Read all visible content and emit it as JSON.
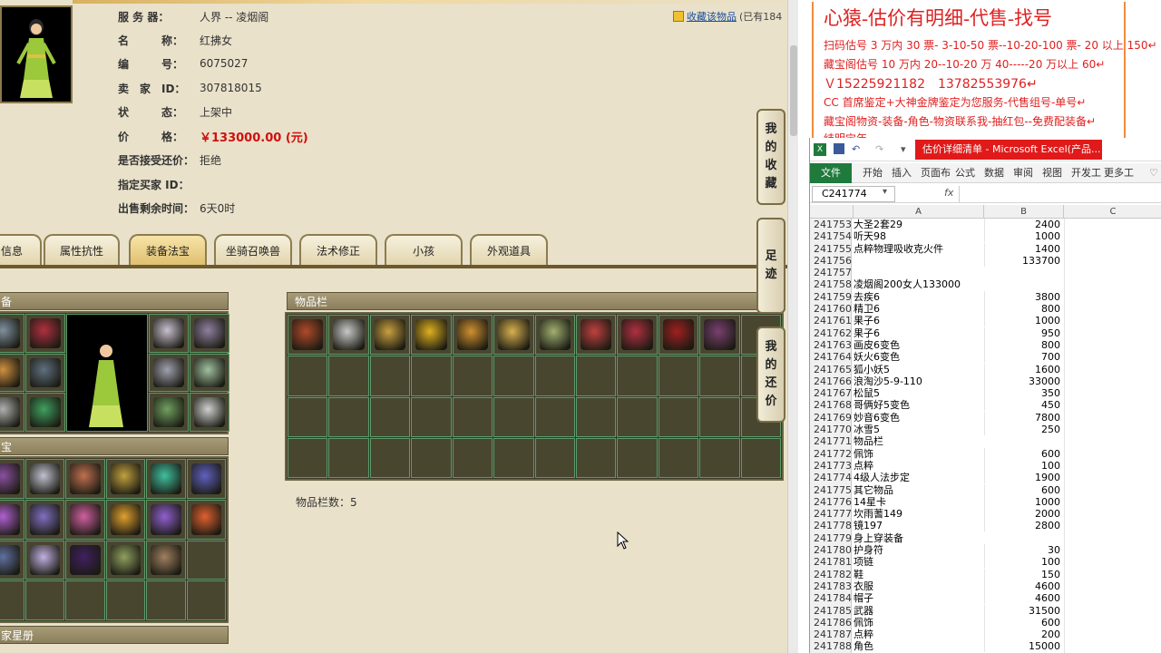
{
  "seller_info": {
    "server_label": "服 务 器：",
    "server_value": "人界 -- 凌烟阁",
    "name_label": "名　　　称：",
    "name_value": "红拂女",
    "id_label": "编　　　号：",
    "id_value": "6075027",
    "seller_label": "卖　家　ID：",
    "seller_value": "307818015",
    "status_label": "状　　　态：",
    "status_value": "上架中",
    "price_label": "价　　　格：",
    "price_value": "￥133000.00 (元)",
    "counter_label": "是否接受还价：",
    "counter_value": "拒绝",
    "buyer_label": "指定买家 ID：",
    "buyer_value": "",
    "remaining_label": "出售剩余时间：",
    "remaining_value": "6天0时"
  },
  "favorite": {
    "link_label": "收藏该物品",
    "count_text": "(已有184"
  },
  "tabs": [
    "信息",
    "属性抗性",
    "装备法宝",
    "坐骑召唤兽",
    "法术修正",
    "小孩",
    "外观道具"
  ],
  "panels": {
    "equip_header": "备",
    "fabao_header": "宝",
    "bottom_header": "家星册",
    "inventory_header": "物品栏",
    "inventory_count": "物品栏数：5"
  },
  "side_buttons": [
    {
      "label": "我的收藏",
      "chars": [
        "我",
        "的",
        "收",
        "藏"
      ]
    },
    {
      "label": "足迹",
      "chars": [
        "足",
        "迹"
      ]
    },
    {
      "label": "我的还价",
      "chars": [
        "我",
        "的",
        "还",
        "价"
      ]
    }
  ],
  "promo": {
    "headline": "心猿-估价有明细-代售-找号",
    "line1": "扫码估号 3 万内 30 票- 3-10-50 票--10-20-100 票- 20 以上 150↵",
    "line2": "藏宝阁估号 10 万内 20--10-20 万 40-----20 万以上 60↵",
    "line3": "Ｖ15225921182　13782553976↵",
    "line4": "CC 首席鉴定+大神金牌鉴定为您服务-代售组号-单号↵",
    "line5": "藏宝阁物资-装备-角色-物资联系我-抽红包--免费配装备↵",
    "line6": "结明宝年　……　………　………"
  },
  "excel": {
    "window_title": "估价详细清单 - Microsoft Excel(产品...",
    "ribbon_tabs": [
      "文件",
      "开始",
      "插入",
      "页面布",
      "公式",
      "数据",
      "审阅",
      "视图",
      "开发工",
      "更多工"
    ],
    "name_box": "C241774",
    "fx": "fx",
    "columns": [
      "A",
      "B",
      "C"
    ],
    "rows": [
      {
        "n": "241753",
        "a": "大圣2套29",
        "b": "2400"
      },
      {
        "n": "241754",
        "a": "听天98",
        "b": "1000"
      },
      {
        "n": "241755",
        "a": "点粹物理吸收克火件",
        "b": "1400"
      },
      {
        "n": "241756",
        "a": "",
        "b": "133700"
      },
      {
        "n": "241757",
        "a": "",
        "b": ""
      },
      {
        "n": "241758",
        "a": "凌烟阁200女人133000",
        "b": ""
      },
      {
        "n": "241759",
        "a": "去疾6",
        "b": "3800"
      },
      {
        "n": "241760",
        "a": "精卫6",
        "b": "800"
      },
      {
        "n": "241761",
        "a": "果子6",
        "b": "1000"
      },
      {
        "n": "241762",
        "a": "果子6",
        "b": "950"
      },
      {
        "n": "241763",
        "a": "画皮6变色",
        "b": "800"
      },
      {
        "n": "241764",
        "a": "妖火6变色",
        "b": "700"
      },
      {
        "n": "241765",
        "a": "狐小妖5",
        "b": "1600"
      },
      {
        "n": "241766",
        "a": "浪淘沙5-9-110",
        "b": "33000"
      },
      {
        "n": "241767",
        "a": "松鼠5",
        "b": "350"
      },
      {
        "n": "241768",
        "a": "哥俩好5变色",
        "b": "450"
      },
      {
        "n": "241769",
        "a": "妙音6变色",
        "b": "7800"
      },
      {
        "n": "241770",
        "a": "冰雪5",
        "b": "250"
      },
      {
        "n": "241771",
        "a": "物品栏",
        "b": ""
      },
      {
        "n": "241772",
        "a": "佩饰",
        "b": "600"
      },
      {
        "n": "241773",
        "a": "点粹",
        "b": "100"
      },
      {
        "n": "241774",
        "a": "4级人法步定",
        "b": "1900"
      },
      {
        "n": "241775",
        "a": "其它物品",
        "b": "600"
      },
      {
        "n": "241776",
        "a": "14星卡",
        "b": "1000"
      },
      {
        "n": "241777",
        "a": "坎雨蓍149",
        "b": "2000"
      },
      {
        "n": "241778",
        "a": "镜197",
        "b": "2800"
      },
      {
        "n": "241779",
        "a": "身上穿装备",
        "b": ""
      },
      {
        "n": "241780",
        "a": "护身符",
        "b": "30"
      },
      {
        "n": "241781",
        "a": "项链",
        "b": "100"
      },
      {
        "n": "241782",
        "a": "鞋",
        "b": "150"
      },
      {
        "n": "241783",
        "a": "衣服",
        "b": "4600"
      },
      {
        "n": "241784",
        "a": "帽子",
        "b": "4600"
      },
      {
        "n": "241785",
        "a": "武器",
        "b": "31500"
      },
      {
        "n": "241786",
        "a": "佩饰",
        "b": "600"
      },
      {
        "n": "241787",
        "a": "点粹",
        "b": "200"
      },
      {
        "n": "241788",
        "a": "角色",
        "b": "15000"
      }
    ]
  },
  "inventory_item_colors": [
    "#b04a2a",
    "#c8c8c8",
    "#c8a040",
    "#e0b020",
    "#d09030",
    "#d8b050",
    "#a0b070",
    "#c04040",
    "#b03040",
    "#a02020",
    "#7a4070"
  ],
  "equip_item_colors": [
    "#8090a0",
    "#b03040",
    "#c8c0d0",
    "#9080a0",
    "#d09040",
    "#607080",
    "#a0a0b0",
    "#a0c0a0",
    "#b0b0b0",
    "#40a060",
    "#70a060",
    "#d0d0d0"
  ],
  "fabao_item_colors": [
    "#8a50a0",
    "#c0c0d0",
    "#c07050",
    "#c0a040",
    "#40c0a0",
    "#6060c0",
    "#b060d0",
    "#8070c0",
    "#d060a0",
    "#e0a030",
    "#9060d0",
    "#e06030",
    "#6070a0",
    "#c0b0e0",
    "#402060",
    "#90a060",
    "#a08060"
  ]
}
